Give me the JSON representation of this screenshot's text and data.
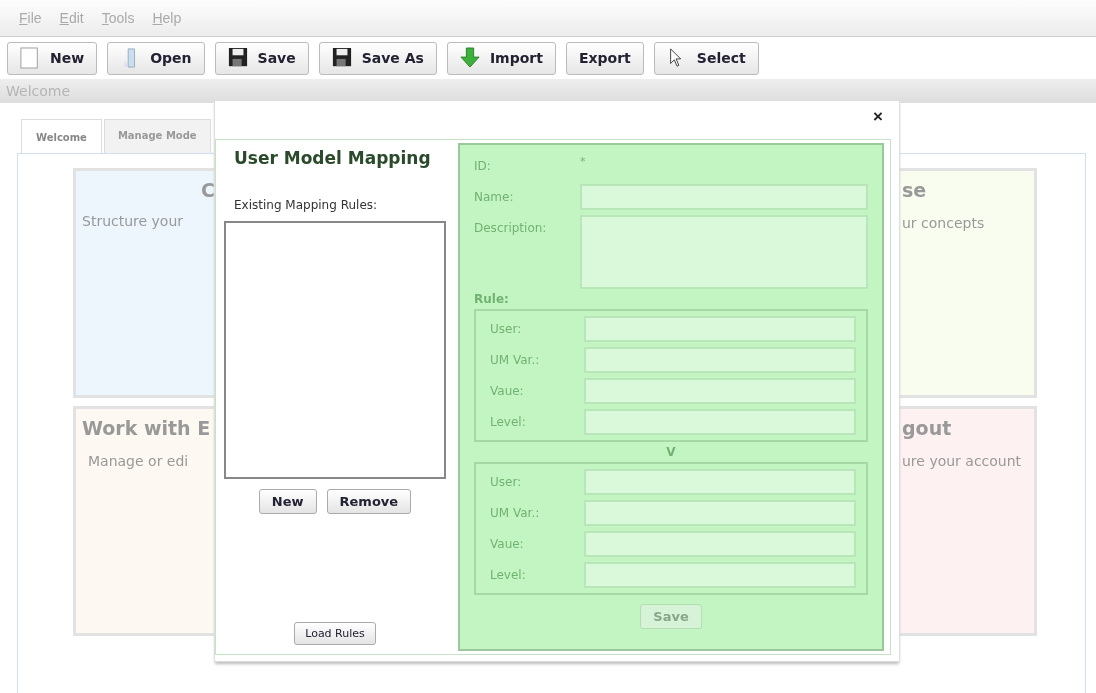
{
  "menu": [
    "File",
    "Edit",
    "Tools",
    "Help"
  ],
  "toolbar": [
    {
      "label": "New"
    },
    {
      "label": "Open"
    },
    {
      "label": "Save"
    },
    {
      "label": "Save As"
    },
    {
      "label": "Import"
    },
    {
      "label": "Export"
    },
    {
      "label": "Select"
    }
  ],
  "breadcrumb": "Welcome",
  "tabs": [
    {
      "label": "Welcome",
      "selected": true
    },
    {
      "label": "Manage Mode",
      "selected": false
    }
  ],
  "cards": [
    {
      "color": "#eef6fd",
      "title": "C",
      "text": "Structure your"
    },
    {
      "color": "#f8fdf0",
      "title": "se",
      "text": "ur concepts"
    },
    {
      "color": "#fdf8f1",
      "title": "Work with E",
      "text": "Manage or edi"
    },
    {
      "color": "#fdf1f1",
      "title": "gout",
      "text": "ure your account"
    }
  ],
  "dialog": {
    "close": "×",
    "title": "User Model Mapping",
    "list_label": "Existing Mapping Rules:",
    "list_buttons": [
      "New",
      "Remove"
    ],
    "load_button": "Load Rules",
    "editor": {
      "disabled": true,
      "id_label": "ID:",
      "id_value": "*",
      "name_label": "Name:",
      "description_label": "Description:",
      "rule_label": "Rule:",
      "conditions": [
        {
          "fields": [
            "User:",
            "UM Var.:",
            "Vaue:",
            "Level:"
          ]
        },
        {
          "fields": [
            "User:",
            "UM Var.:",
            "Vaue:",
            "Level:"
          ]
        }
      ],
      "separator": "V",
      "save": "Save"
    }
  }
}
